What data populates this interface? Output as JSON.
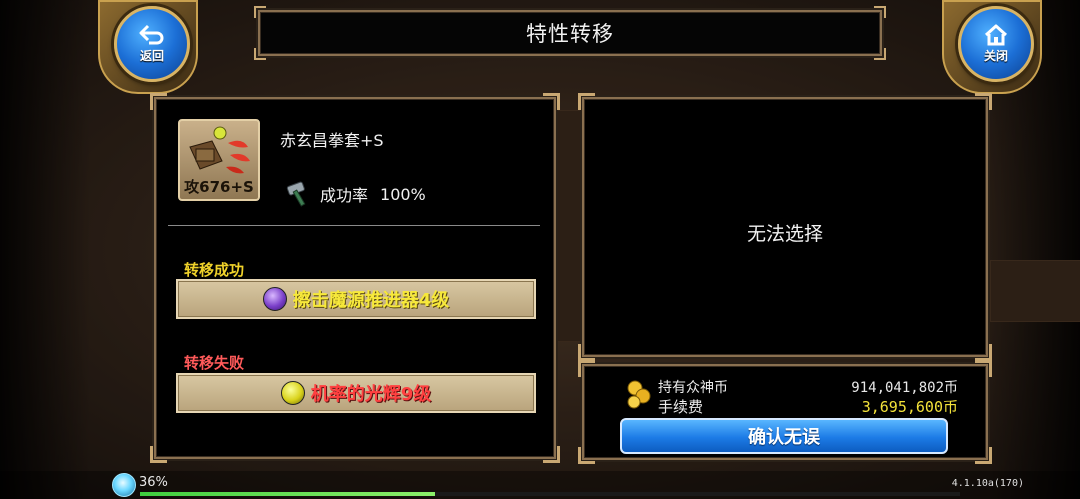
{
  "header": {
    "title": "特性转移",
    "back_label": "返回",
    "close_label": "关闭"
  },
  "item": {
    "name": "赤玄昌拳套+S",
    "attack": "攻676+S",
    "success_label": "成功率",
    "success_value": "100%"
  },
  "results": {
    "success_title": "转移成功",
    "success_effect": "擦击魔源推进器4级",
    "fail_title": "转移失败",
    "fail_effect": "机率的光辉9级"
  },
  "target": {
    "status": "无法选择"
  },
  "fee": {
    "owned_label": "持有众神币",
    "owned_value": "914,041,802币",
    "fee_label": "手续费",
    "fee_value": "3,695,600币",
    "confirm_label": "确认无误"
  },
  "status_bar": {
    "exp_percent": "36%",
    "exp_fraction": 0.36,
    "version": "4.1.10a(170)"
  },
  "colors": {
    "success_title": "#f0d22a",
    "success_text": "#f7e93a",
    "fail_title": "#ff5a5a",
    "fail_text": "#ff4040",
    "fee_value": "#f3e23a",
    "panel_border": "#8a7050",
    "confirm_blue": "#1c7be6"
  },
  "icons": {
    "back": "back-arrow-icon",
    "close": "home-icon",
    "coin": "coin-stack-icon",
    "hammer": "hammer-icon",
    "success_gem": "purple-orb-icon",
    "fail_gem": "yellow-orb-icon",
    "exp": "exp-orb-icon"
  }
}
